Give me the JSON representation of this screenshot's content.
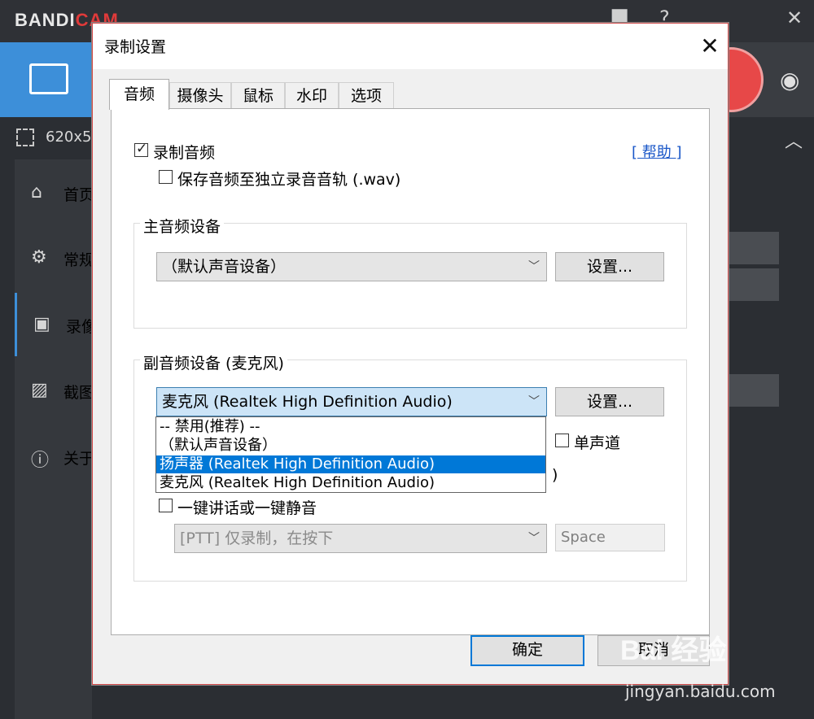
{
  "app": {
    "brand": "BANDICAM",
    "size_text": "620x5",
    "sidebar": [
      "首页",
      "常规",
      "录像",
      "截图",
      "关于"
    ]
  },
  "dialog": {
    "title": "录制设置",
    "close": "✕",
    "tabs": [
      "音频",
      "摄像头",
      "鼠标",
      "水印",
      "选项"
    ],
    "record_audio": "录制音频",
    "save_wav": "保存音频至独立录音音轨 (.wav)",
    "help": "[ 帮助 ]",
    "primary_group": "主音频设备",
    "primary_device": "（默认声音设备）",
    "primary_settings": "设置...",
    "secondary_group": "副音频设备 (麦克风)",
    "secondary_device": "麦克风 (Realtek High Definition Audio)",
    "secondary_settings": "设置...",
    "dropdown_items": [
      "-- 禁用(推荐) --",
      "（默认声音设备）",
      "扬声器 (Realtek High Definition Audio)",
      "麦克风 (Realtek High Definition Audio)"
    ],
    "mono": "单声道",
    "partial_paren": ")",
    "ptt": "一键讲话或一键静音",
    "ptt_mode": "[PTT] 仅录制，在按下",
    "ptt_key": "Space",
    "ok": "确定",
    "cancel": "取消"
  },
  "watermark": {
    "brand": "Bai 经验",
    "url": "jingyan.baidu.com"
  }
}
